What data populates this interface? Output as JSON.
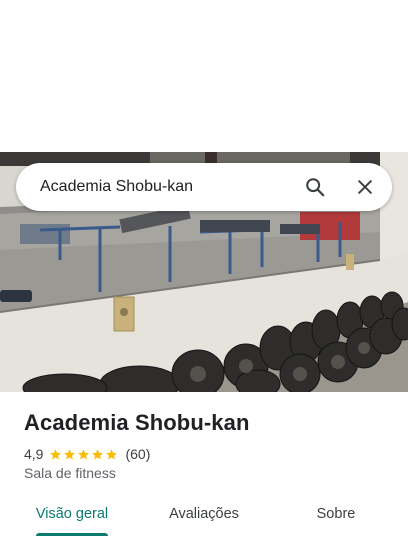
{
  "search": {
    "query": "Academia Shobu-kan"
  },
  "place": {
    "name": "Academia Shobu-kan",
    "rating": "4,9",
    "stars": 5,
    "review_count": "(60)",
    "category": "Sala de fitness"
  },
  "tabs": [
    {
      "label": "Visão geral",
      "active": true
    },
    {
      "label": "Avaliações",
      "active": false
    },
    {
      "label": "Sobre",
      "active": false
    }
  ],
  "colors": {
    "accent": "#0b7a6f",
    "star": "#fbbc04"
  },
  "icons": {
    "search": "search-icon",
    "close": "close-icon",
    "star": "star-icon"
  }
}
